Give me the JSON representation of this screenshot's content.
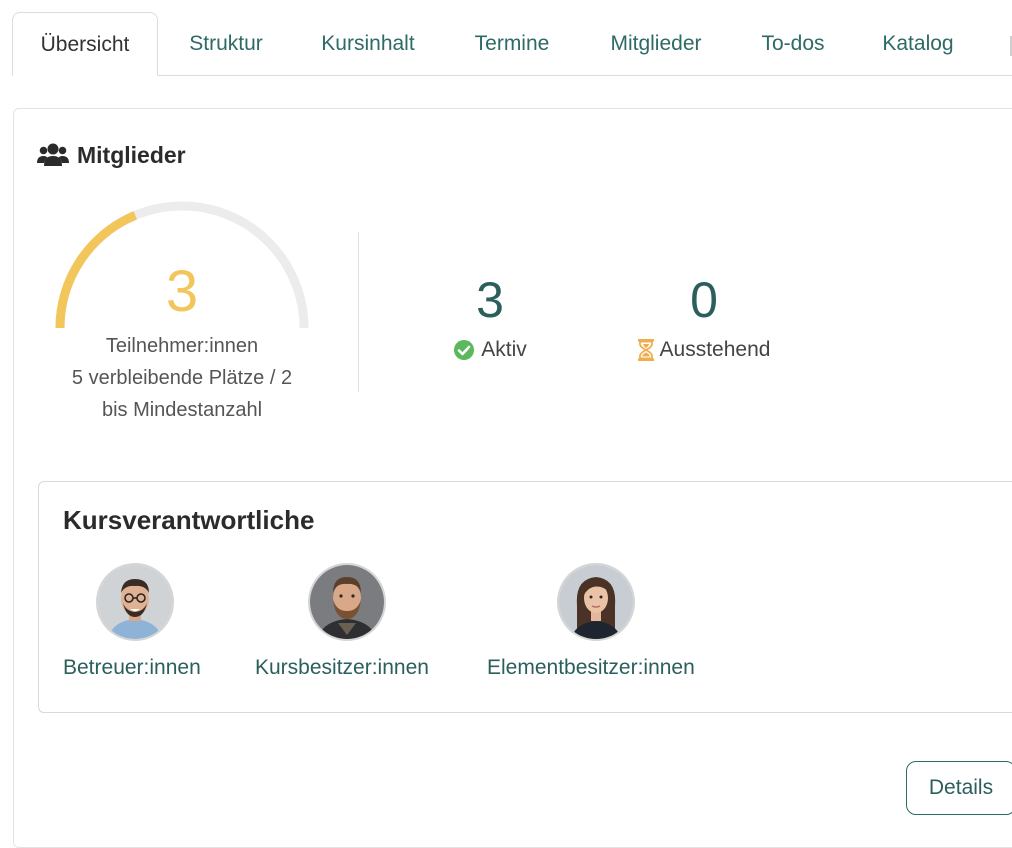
{
  "tabs": [
    {
      "label": "Übersicht",
      "active": true
    },
    {
      "label": "Struktur"
    },
    {
      "label": "Kursinhalt"
    },
    {
      "label": "Termine"
    },
    {
      "label": "Mitglieder"
    },
    {
      "label": "To-dos"
    },
    {
      "label": "Katalog"
    }
  ],
  "members": {
    "title": "Mitglieder",
    "icon": "users-icon",
    "gauge": {
      "value": "3",
      "fill_fraction": 0.375,
      "color": "#f2c65a",
      "track_color": "#ececec",
      "caption": [
        "Teilnehmer:innen",
        "5 verbleibende Plätze / 2",
        "bis Mindestanzahl"
      ]
    },
    "active": {
      "number": "3",
      "label": "Aktiv",
      "icon": "check-circle-icon",
      "color": "#5cb85c"
    },
    "pending": {
      "number": "0",
      "label": "Ausstehend",
      "icon": "hourglass-icon",
      "color": "#f0ad4e"
    }
  },
  "owners": {
    "title": "Kursverantwortliche",
    "items": [
      {
        "label": "Betreuer:innen",
        "avatar": "avatar-man-glasses"
      },
      {
        "label": "Kursbesitzer:innen",
        "avatar": "avatar-man-beard"
      },
      {
        "label": "Elementbesitzer:innen",
        "avatar": "avatar-woman"
      }
    ]
  },
  "details_button": "Details",
  "colors": {
    "accent": "#2e6a66",
    "text": "#2b2b2b"
  }
}
